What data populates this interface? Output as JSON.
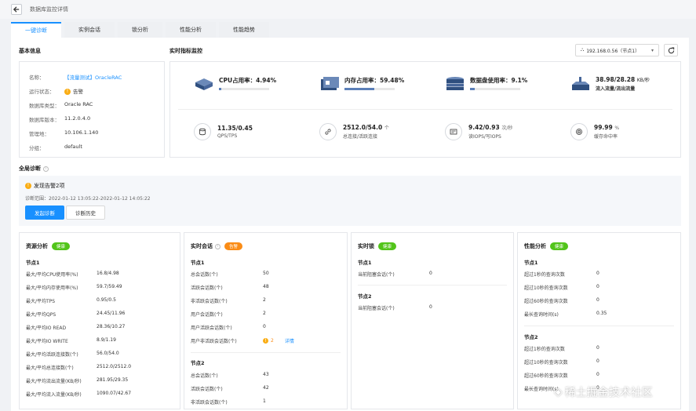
{
  "page": {
    "title": "数据库监控详情"
  },
  "tabs": [
    "一键诊断",
    "实例会话",
    "锁分析",
    "性能分析",
    "性能趋势"
  ],
  "basic_info": {
    "section_title": "基本信息",
    "rows": [
      {
        "k": "名称：",
        "v": "【流量测试】OracleRAC"
      },
      {
        "k": "运行状态：",
        "v": "告警"
      },
      {
        "k": "数据库类型：",
        "v": "Oracle RAC"
      },
      {
        "k": "数据库版本：",
        "v": "11.2.0.4.0"
      },
      {
        "k": "管理地：",
        "v": "10.106.1.140"
      },
      {
        "k": "分组：",
        "v": "default"
      }
    ]
  },
  "realtime": {
    "section_title": "实时指标监控",
    "node_select": "192.168.0.56（节点1）",
    "cpu": {
      "label": "CPU占用率：4.94%",
      "percent": 4.94
    },
    "mem": {
      "label": "内存占用率：59.48%",
      "percent": 59.48
    },
    "disk": {
      "label": "数据盘使用率：9.1%",
      "percent": 9.1
    },
    "traffic": {
      "value": "38.98/28.28",
      "unit": "KB/秒",
      "sub": "流入流量/流出流量"
    },
    "qps": {
      "value": "11.35/0.45",
      "sub": "QPS/TPS"
    },
    "conn": {
      "value": "2512.0/54.0",
      "unit": "个",
      "sub": "总连接/活跃连接"
    },
    "iops": {
      "value": "9.42/0.93",
      "unit": "次/秒",
      "sub": "读IOPS/写IOPS"
    },
    "hit": {
      "value": "99.99",
      "unit": "%",
      "sub": "缓存命中率"
    }
  },
  "diagnosis": {
    "section_title": "全局诊断",
    "found": "发现告警2项",
    "range": "诊断范围：2022-01-12 13:05:22-2022-01-12 14:05:22",
    "btn_start": "发起诊断",
    "btn_history": "诊断历史"
  },
  "panels": {
    "resource": {
      "title": "资源分析",
      "badge": "健康",
      "node1": "节点1",
      "rows": [
        {
          "k": "最大/平均CPU使用率(%)",
          "v": "16.8/4.98"
        },
        {
          "k": "最大/平均内存使用率(%)",
          "v": "59.7/59.49"
        },
        {
          "k": "最大/平均TPS",
          "v": "0.95/0.5"
        },
        {
          "k": "最大/平均QPS",
          "v": "24.45/11.96"
        },
        {
          "k": "最大/平均IO READ",
          "v": "28.36/10.27"
        },
        {
          "k": "最大/平均IO WRITE",
          "v": "8.9/1.19"
        },
        {
          "k": "最大/平均活跃连接数(个)",
          "v": "56.0/54.0"
        },
        {
          "k": "最大/平均总连接数(个)",
          "v": "2512.0/2512.0"
        },
        {
          "k": "最大/平均流出流量(KB/秒)",
          "v": "281.95/29.35"
        },
        {
          "k": "最大/平均流入流量(KB/秒)",
          "v": "1090.07/42.67"
        }
      ]
    },
    "session": {
      "title": "实时会话",
      "badge": "告警",
      "node1": "节点1",
      "rows": [
        {
          "k": "总会话数(个)",
          "v": "50"
        },
        {
          "k": "活跃会话数(个)",
          "v": "48"
        },
        {
          "k": "非活跃会话数(个)",
          "v": "2"
        },
        {
          "k": "用户会话数(个)",
          "v": "2"
        },
        {
          "k": "用户活跃会话数(个)",
          "v": "0"
        },
        {
          "k": "用户非活跃会话数(个)",
          "v": "2",
          "link": "详情"
        }
      ],
      "node2": "节点2",
      "rows2": [
        {
          "k": "总会话数(个)",
          "v": "43"
        },
        {
          "k": "活跃会话数(个)",
          "v": "42"
        },
        {
          "k": "非活跃会话数(个)",
          "v": "1"
        }
      ]
    },
    "lock": {
      "title": "实时锁",
      "badge": "健康",
      "node1": "节点1",
      "row1": {
        "k": "当前阻塞会话(个)",
        "v": "0"
      },
      "node2": "节点2",
      "row2": {
        "k": "当前阻塞会话(个)",
        "v": "0"
      }
    },
    "perf": {
      "title": "性能分析",
      "badge": "健康",
      "node1": "节点1",
      "rows": [
        {
          "k": "超过1秒的查询次数",
          "v": "0"
        },
        {
          "k": "超过10秒的查询次数",
          "v": "0"
        },
        {
          "k": "超过60秒的查询次数",
          "v": "0"
        },
        {
          "k": "最长查询时间(s)",
          "v": "0.35"
        }
      ],
      "node2": "节点2",
      "rows2": [
        {
          "k": "超过1秒的查询次数",
          "v": "0"
        },
        {
          "k": "超过10秒的查询次数",
          "v": "0"
        },
        {
          "k": "超过60秒的查询次数",
          "v": "0"
        },
        {
          "k": "最长查询时间(s)",
          "v": "0"
        }
      ]
    }
  },
  "watermark": "稀土掘金技术社区",
  "colors": {
    "accent": "#1890ff",
    "healthy": "#52c41a",
    "warn": "#fa8c16"
  }
}
